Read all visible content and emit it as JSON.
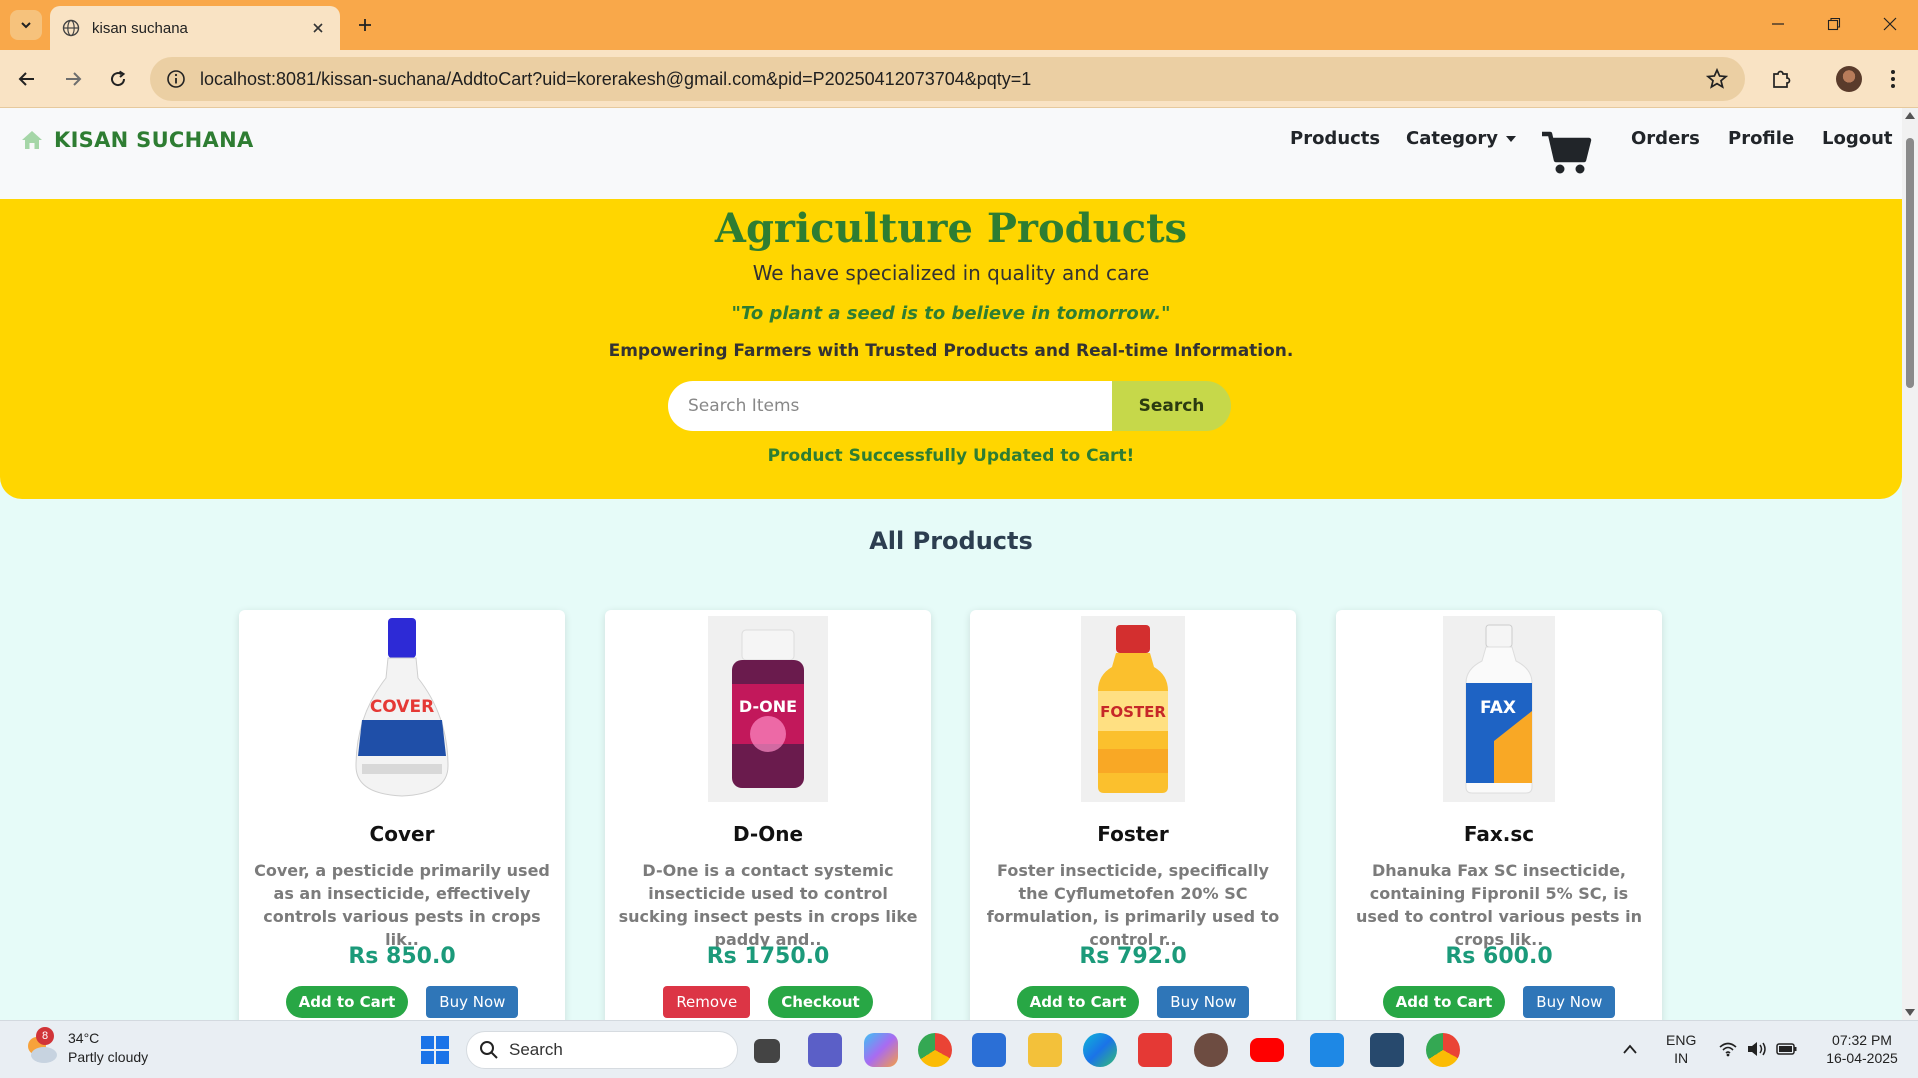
{
  "browser": {
    "tab_title": "kisan suchana",
    "url": "localhost:8081/kissan-suchana/AddtoCart?uid=korerakesh@gmail.com&pid=P20250412073704&pqty=1"
  },
  "site": {
    "brand": "KISAN SUCHANA",
    "nav": {
      "products": "Products",
      "category": "Category",
      "orders": "Orders",
      "profile": "Profile",
      "logout": "Logout"
    }
  },
  "hero": {
    "title": "Agriculture Products",
    "subtitle": "We have specialized in quality and care",
    "quote": "\"To plant a seed is to believe in tomorrow.\"",
    "tagline": "Empowering Farmers with Trusted Products and Real-time Information.",
    "search_placeholder": "Search Items",
    "search_button": "Search",
    "message": "Product Successfully Updated to Cart!"
  },
  "section_title": "All Products",
  "products": [
    {
      "name": "Cover",
      "description": "Cover, a pesticide primarily used as an insecticide, effectively controls various pests in crops lik..",
      "price": "Rs 850.0",
      "btn1": "Add to Cart",
      "btn2": "Buy Now"
    },
    {
      "name": "D-One",
      "description": "D-One is a contact systemic insecticide used to control sucking insect pests in crops like paddy and..",
      "price": "Rs 1750.0",
      "btn1": "Remove",
      "btn2": "Checkout"
    },
    {
      "name": "Foster",
      "description": "Foster insecticide, specifically the Cyflumetofen 20% SC formulation, is primarily used to control r..",
      "price": "Rs 792.0",
      "btn1": "Add to Cart",
      "btn2": "Buy Now"
    },
    {
      "name": "Fax.sc",
      "description": "Dhanuka Fax SC insecticide, containing Fipronil 5% SC, is used to control various pests in crops lik..",
      "price": "Rs 600.0",
      "btn1": "Add to Cart",
      "btn2": "Buy Now"
    }
  ],
  "product_labels": {
    "cover": "COVER",
    "done": "D-ONE",
    "foster": "FOSTER",
    "fax": "FAX"
  },
  "taskbar": {
    "weather_badge": "8",
    "temperature": "34°C",
    "weather": "Partly cloudy",
    "search": "Search",
    "lang1": "ENG",
    "lang2": "IN",
    "time": "07:32 PM",
    "date": "16-04-2025"
  },
  "colors": {
    "tabbar": "#f9a84a",
    "hero": "#ffd600",
    "brand_green": "#2e7d32",
    "price_teal": "#1b9a7a"
  }
}
